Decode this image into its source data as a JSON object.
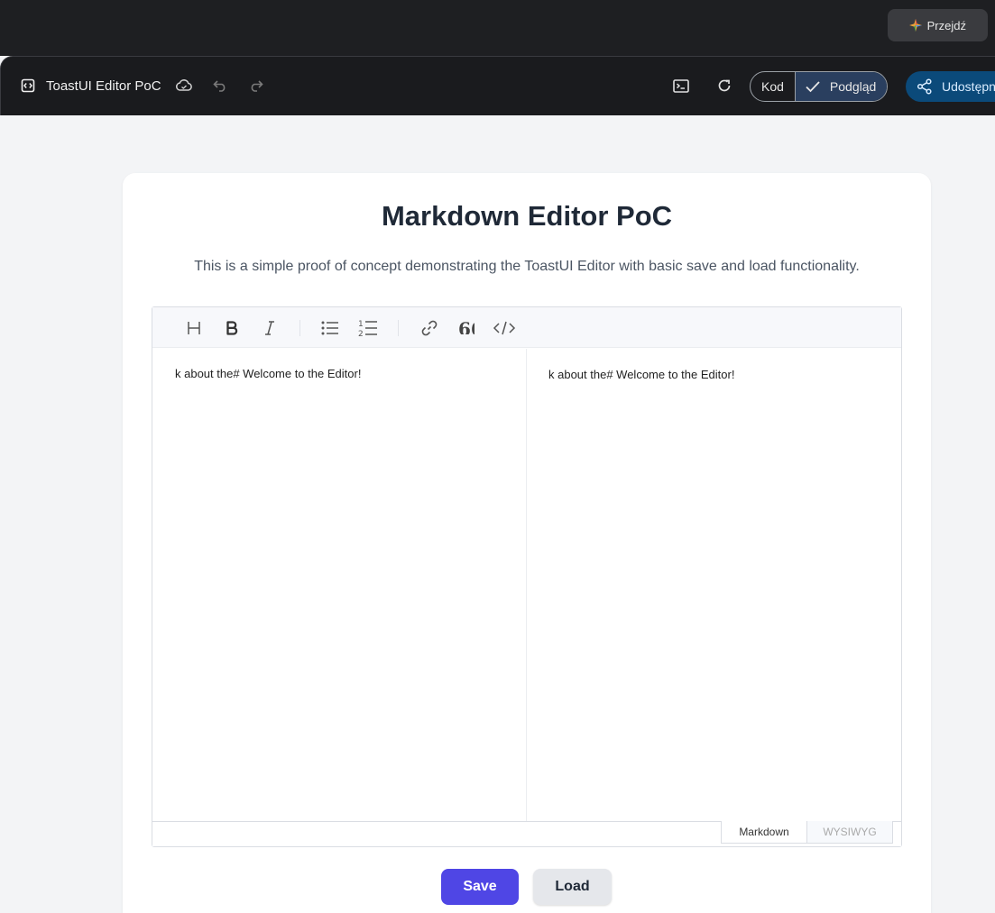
{
  "top": {
    "go_label": "Przejdź"
  },
  "appbar": {
    "title": "ToastUI Editor PoC",
    "toggle": {
      "code_label": "Kod",
      "preview_label": "Podgląd",
      "active": "preview"
    },
    "share_label": "Udostępn"
  },
  "page": {
    "heading": "Markdown Editor PoC",
    "subheading": "This is a simple proof of concept demonstrating the ToastUI Editor with basic save and load functionality."
  },
  "editor": {
    "toolbar": [
      "heading-icon",
      "bold-icon",
      "italic-icon",
      "bullet-list-icon",
      "ordered-list-icon",
      "link-icon",
      "quote-icon",
      "code-block-icon"
    ],
    "markdown_content": "k about the# Welcome to the Editor!",
    "preview_content": "k about the# Welcome to the Editor!",
    "modes": {
      "markdown": "Markdown",
      "wysiwyg": "WYSIWYG",
      "active": "markdown"
    }
  },
  "actions": {
    "save_label": "Save",
    "load_label": "Load"
  },
  "colors": {
    "primary": "#4f46e5",
    "share": "#0b4a7a",
    "toggle_active": "#2a3f5f"
  }
}
